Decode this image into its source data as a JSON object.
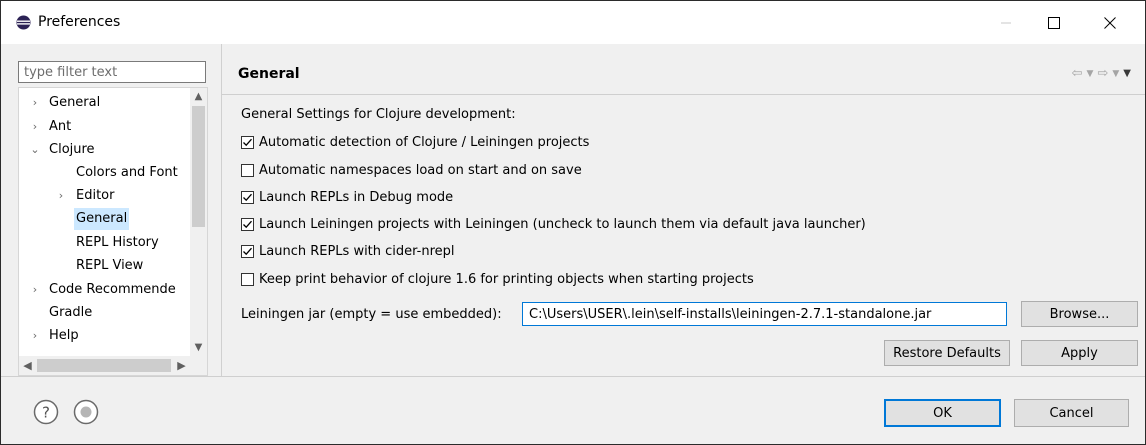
{
  "window": {
    "title": "Preferences",
    "icon": "eclipse-icon",
    "controls": [
      "minimize",
      "maximize",
      "close"
    ]
  },
  "filter": {
    "placeholder": "type filter text",
    "value": ""
  },
  "tree": {
    "items": [
      {
        "label": "General",
        "arrow": "›",
        "selected": false
      },
      {
        "label": "Ant",
        "arrow": "›",
        "selected": false
      },
      {
        "label": "Clojure",
        "arrow": "⌄",
        "selected": false
      },
      {
        "label": "Colors and Font",
        "arrow": "",
        "selected": false
      },
      {
        "label": "Editor",
        "arrow": "›",
        "selected": false
      },
      {
        "label": "General",
        "arrow": "",
        "selected": true
      },
      {
        "label": "REPL History",
        "arrow": "",
        "selected": false
      },
      {
        "label": "REPL View",
        "arrow": "",
        "selected": false
      },
      {
        "label": "Code Recommende",
        "arrow": "›",
        "selected": false
      },
      {
        "label": "Gradle",
        "arrow": "",
        "selected": false
      },
      {
        "label": "Help",
        "arrow": "›",
        "selected": false
      }
    ]
  },
  "page": {
    "title": "General",
    "section_title": "General Settings for Clojure development:",
    "options": [
      {
        "label": "Automatic detection of Clojure / Leiningen projects",
        "checked": true
      },
      {
        "label": "Automatic namespaces load on start and on save",
        "checked": false
      },
      {
        "label": "Launch REPLs in Debug mode",
        "checked": true
      },
      {
        "label": "Launch Leiningen projects with Leiningen (uncheck to launch them via default java launcher)",
        "checked": true
      },
      {
        "label": "Launch REPLs with cider-nrepl",
        "checked": true
      },
      {
        "label": "Keep print behavior of clojure 1.6 for printing objects when starting projects",
        "checked": false
      }
    ],
    "jar_label": "Leiningen jar (empty = use embedded):",
    "jar_value": "C:\\Users\\USER\\.lein\\self-installs\\leiningen-2.7.1-standalone.jar",
    "browse_label": "Browse...",
    "restore_label": "Restore Defaults",
    "apply_label": "Apply"
  },
  "footer": {
    "ok_label": "OK",
    "cancel_label": "Cancel"
  },
  "colors": {
    "accent": "#0078d7",
    "selection": "#cce8ff",
    "button": "#e1e1e1"
  }
}
